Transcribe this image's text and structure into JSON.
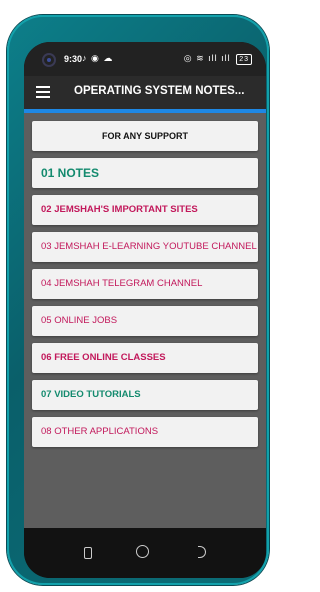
{
  "status_bar": {
    "time": "9:30",
    "left_icons": "♪ ◉ ☁",
    "right_icons": "◎ ≋ ıll ıll",
    "battery": "23"
  },
  "app_bar": {
    "title": "OPERATING SYSTEM NOTES..."
  },
  "colors": {
    "accent": "#1e88e5",
    "pink": "#c2185b",
    "teal": "#138a6e"
  },
  "menu": {
    "support": "FOR ANY SUPPORT",
    "items": [
      {
        "label": "01 NOTES"
      },
      {
        "label": "02 JEMSHAH'S IMPORTANT SITES"
      },
      {
        "label": "03 JEMSHAH E-LEARNING YOUTUBE CHANNEL"
      },
      {
        "label": "04 JEMSHAH TELEGRAM CHANNEL"
      },
      {
        "label": "05 ONLINE JOBS"
      },
      {
        "label": "06 FREE ONLINE CLASSES"
      },
      {
        "label": "07 VIDEO TUTORIALS"
      },
      {
        "label": "08 OTHER APPLICATIONS"
      }
    ]
  }
}
